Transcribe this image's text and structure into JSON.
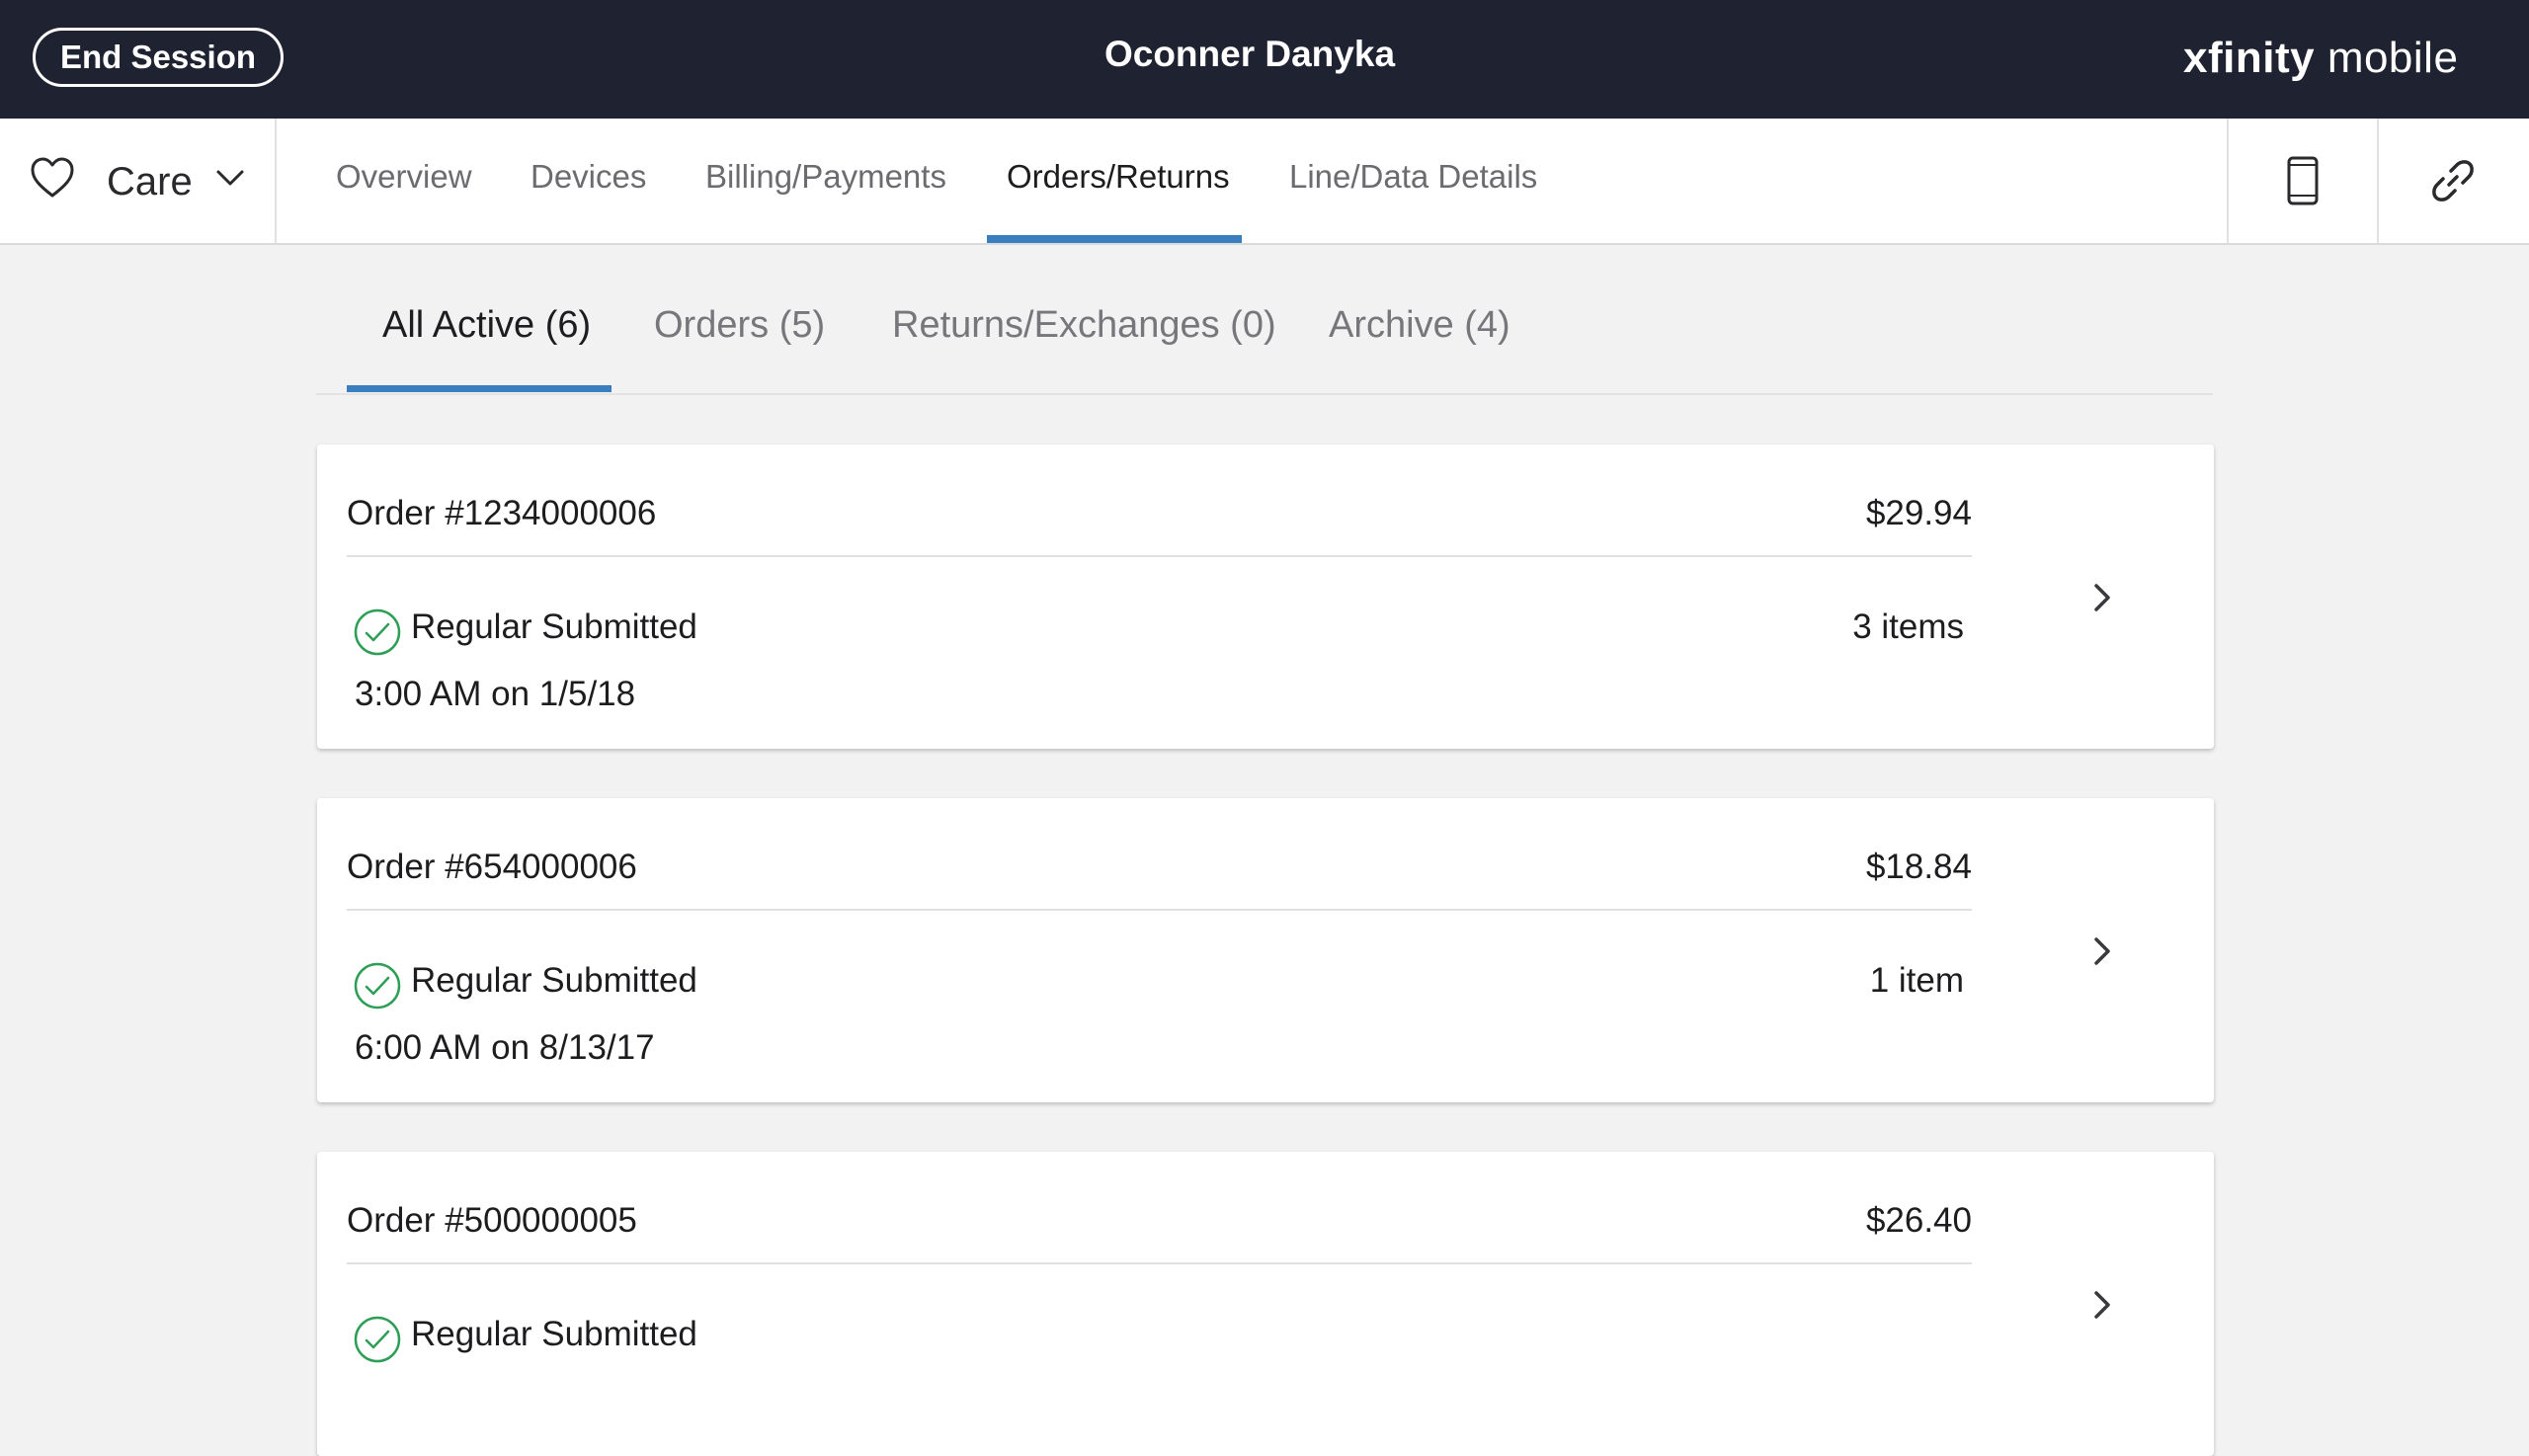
{
  "header": {
    "end_session_label": "End Session",
    "customer_name": "Oconner Danyka",
    "brand_part1": "xfinity",
    "brand_part2": "mobile"
  },
  "nav": {
    "care_label": "Care",
    "tabs": [
      {
        "label": "Overview",
        "active": false
      },
      {
        "label": "Devices",
        "active": false
      },
      {
        "label": "Billing/Payments",
        "active": false
      },
      {
        "label": "Orders/Returns",
        "active": true
      },
      {
        "label": "Line/Data Details",
        "active": false
      }
    ],
    "right_icons": [
      "phone-icon",
      "link-icon"
    ]
  },
  "subtabs": [
    {
      "label": "All Active (6)",
      "active": true
    },
    {
      "label": "Orders (5)",
      "active": false
    },
    {
      "label": "Returns/Exchanges (0)",
      "active": false
    },
    {
      "label": "Archive (4)",
      "active": false
    }
  ],
  "orders": [
    {
      "order_no": "Order #1234000006",
      "amount": "$29.94",
      "status": "Regular Submitted",
      "items": "3 items",
      "datetime": "3:00 AM on 1/5/18"
    },
    {
      "order_no": "Order #654000006",
      "amount": "$18.84",
      "status": "Regular Submitted",
      "items": "1 item",
      "datetime": "6:00 AM on 8/13/17"
    },
    {
      "order_no": "Order #500000005",
      "amount": "$26.40",
      "status": "Regular Submitted",
      "items": "",
      "datetime": ""
    }
  ],
  "colors": {
    "header_bg": "#1f2331",
    "accent": "#3a7ec0",
    "success": "#2e9e57",
    "page_bg": "#f2f2f3"
  }
}
